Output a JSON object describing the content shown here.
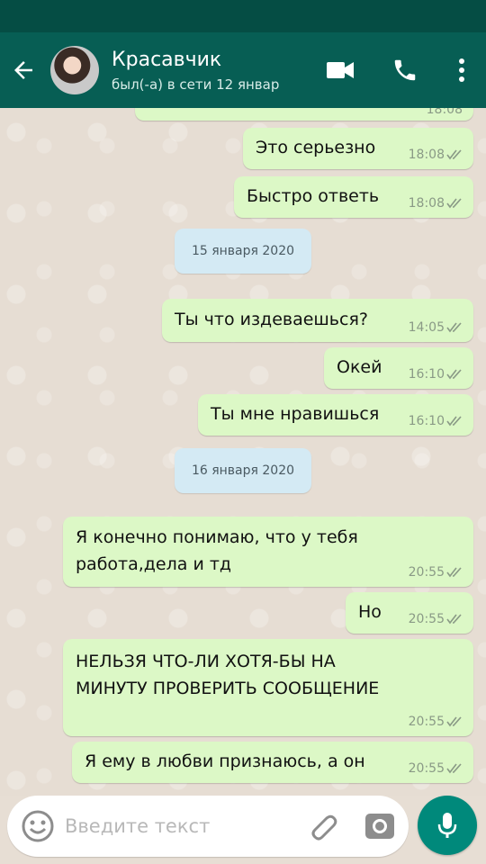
{
  "header": {
    "contact_name": "Красавчик",
    "contact_status": "был(-а) в сети 12 январ",
    "colors": {
      "bar": "#075e54",
      "status_bar": "#054d44"
    },
    "icons": [
      "back-arrow-icon",
      "video-call-icon",
      "phone-icon",
      "more-options-icon"
    ]
  },
  "chat": {
    "messages": [
      {
        "text": "",
        "time": "18:08",
        "status": "read",
        "partial": true
      },
      {
        "text": "Это серьезно",
        "time": "18:08",
        "status": "read"
      },
      {
        "text": "Быстро ответь",
        "time": "18:08",
        "status": "read"
      },
      {
        "date_separator": "15 января 2020"
      },
      {
        "text": "Ты что издеваешься?",
        "time": "14:05",
        "status": "read"
      },
      {
        "text": "Окей",
        "time": "16:10",
        "status": "read"
      },
      {
        "text": "Ты мне нравишься",
        "time": "16:10",
        "status": "read"
      },
      {
        "date_separator": "16 января 2020"
      },
      {
        "text_lines": [
          "Я конечно понимаю, что у тебя",
          "работа,дела и тд"
        ],
        "time": "20:55",
        "status": "read"
      },
      {
        "text": "Но",
        "time": "20:55",
        "status": "read"
      },
      {
        "text_lines": [
          "НЕЛЬЗЯ ЧТО-ЛИ ХОТЯ-БЫ НА",
          "МИНУТУ ПРОВЕРИТЬ СООБЩЕНИЕ"
        ],
        "time": "20:55",
        "status": "read"
      },
      {
        "text": "Я ему в любви признаюсь, а он",
        "time": "20:55",
        "status": "read"
      }
    ],
    "colors": {
      "outgoing_bubble": "#dcf8c6",
      "date_pill": "#d4eaf4",
      "read_ticks": "#8a9a86"
    }
  },
  "input": {
    "placeholder": "Введите текст",
    "value": "",
    "icons": [
      "emoji-icon",
      "attach-icon",
      "camera-icon",
      "mic-icon"
    ],
    "colors": {
      "mic_button": "#00897b"
    }
  }
}
